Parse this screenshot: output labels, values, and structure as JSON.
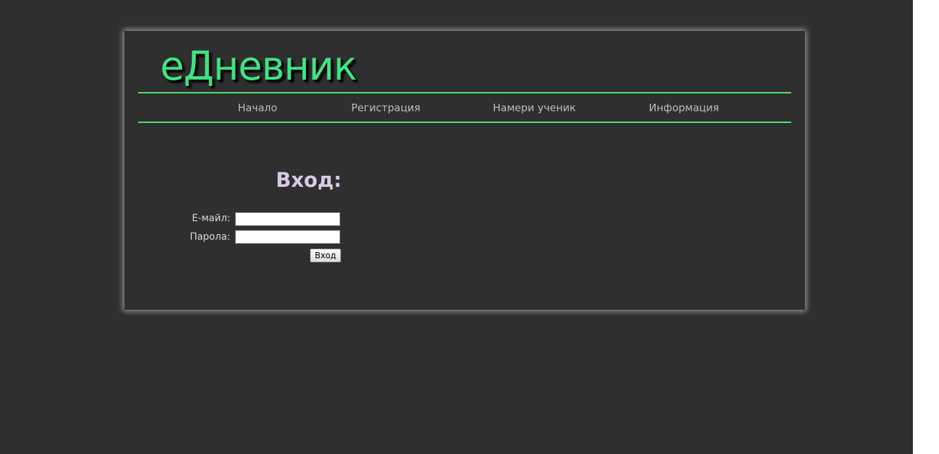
{
  "header": {
    "logo_text": "еДневник"
  },
  "nav": {
    "items": [
      {
        "label": "Начало"
      },
      {
        "label": "Регистрация"
      },
      {
        "label": "Намери ученик"
      },
      {
        "label": "Информация"
      }
    ]
  },
  "login": {
    "title": "Вход:",
    "email_label": "Е-майл:",
    "email_value": "",
    "password_label": "Парола:",
    "password_value": "",
    "submit_label": "Вход"
  },
  "colors": {
    "background": "#2f2f2f",
    "logo": "#3ee483",
    "nav_line": "#55e66e",
    "nav_text": "#bdbdbd",
    "title": "#d9c9e6"
  }
}
